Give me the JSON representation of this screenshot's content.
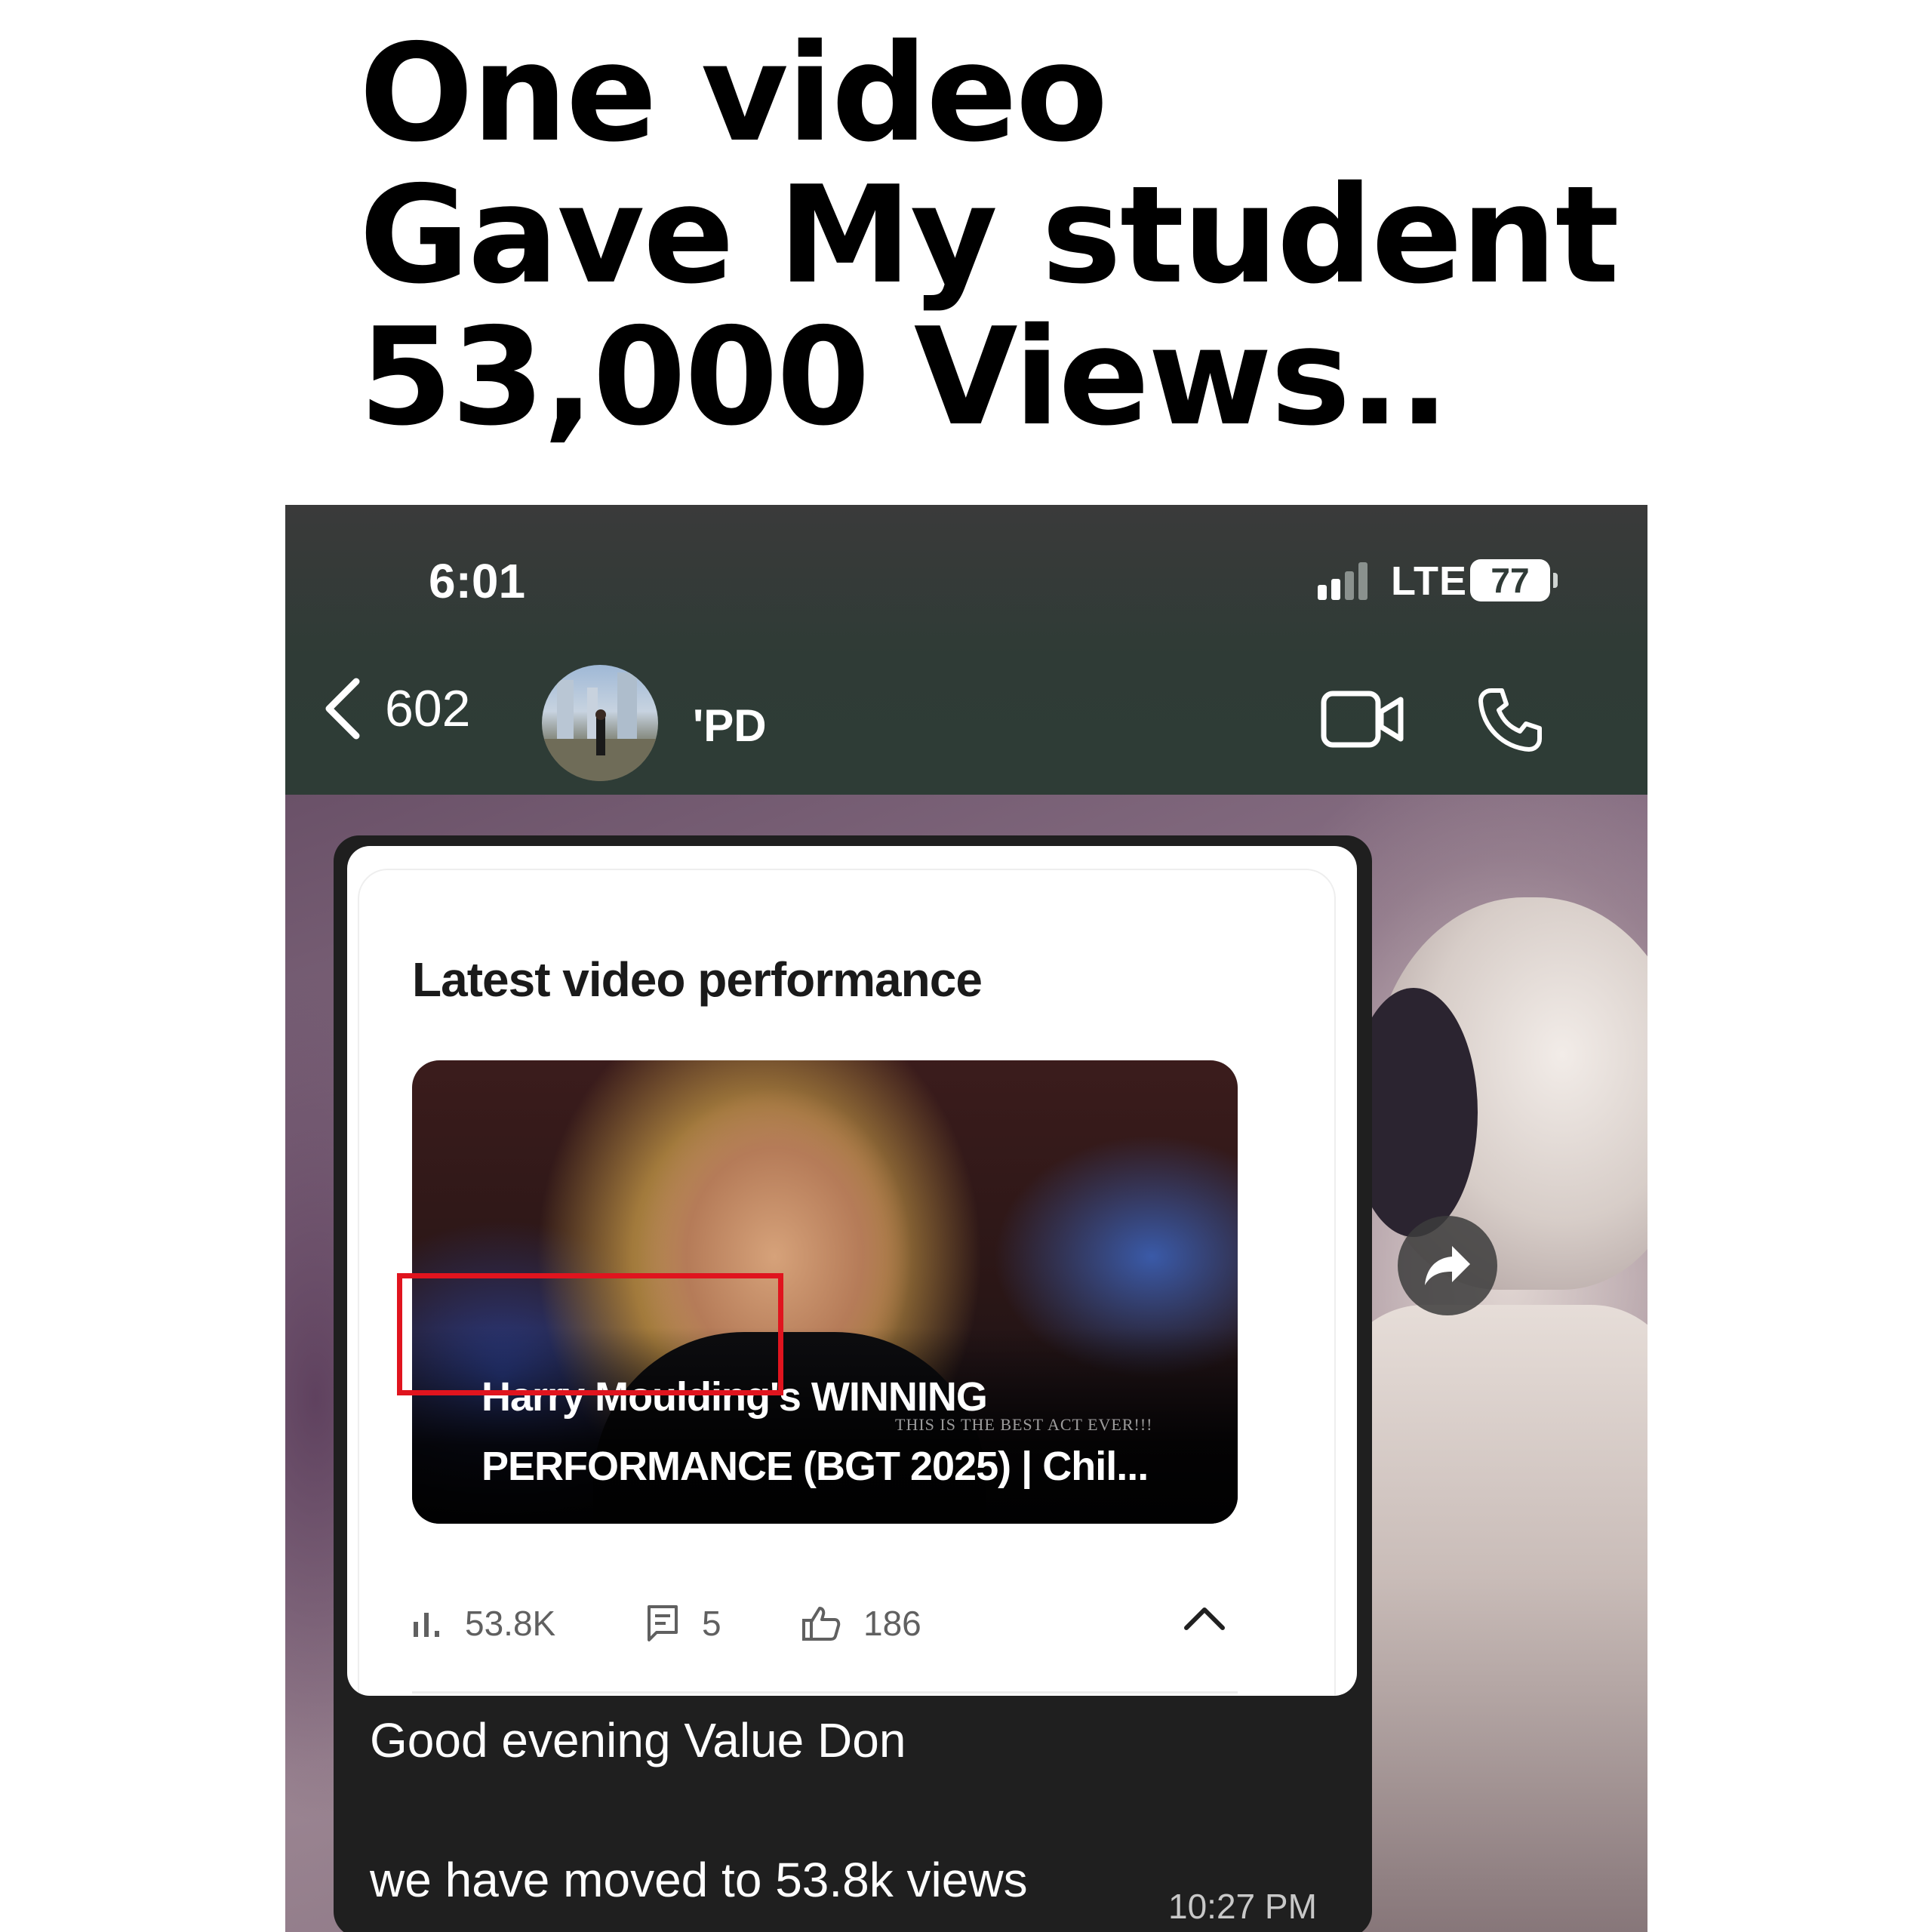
{
  "headline": {
    "line1": "One video",
    "line2": "Gave My student",
    "line3": "53,000 Views.."
  },
  "status_bar": {
    "time": "6:01",
    "network": "LTE",
    "battery": "77",
    "signal_icon": "signal-bars-icon"
  },
  "chat_header": {
    "back_count": "602",
    "contact_name": "'PD",
    "icons": [
      "chevron-left-icon",
      "video-camera-icon",
      "phone-icon"
    ]
  },
  "card": {
    "title": "Latest video performance",
    "video_title_line1": "Harry Moulding's WINNING",
    "video_title_line2": "PERFORMANCE (BGT 2025) | Chil...",
    "thumbnail_overlay": "THIS IS THE BEST ACT EVER!!!",
    "stats": {
      "views": "53.8K",
      "comments": "5",
      "likes": "186"
    }
  },
  "message": {
    "line1": "Good evening Value Don",
    "line2": "we have moved to 53.8k views",
    "time": "10:27 PM"
  },
  "colors": {
    "highlight": "#e0141e",
    "header_bg": "#2e3c36",
    "bubble_bg": "#1f1f1f"
  }
}
